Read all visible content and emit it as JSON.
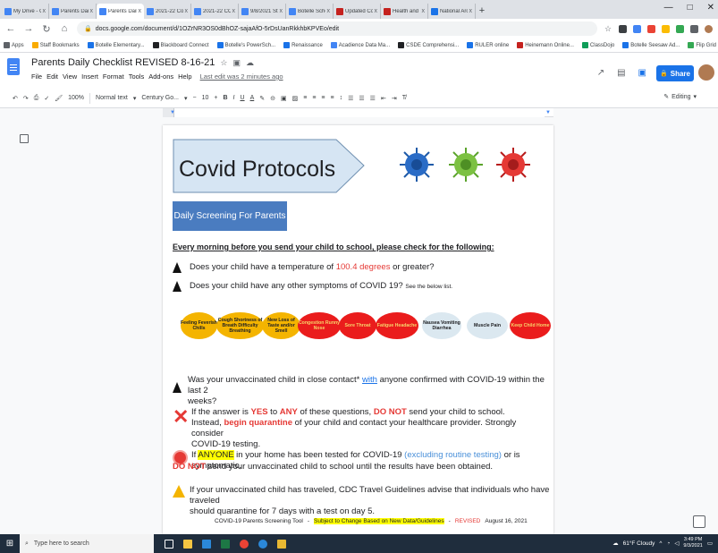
{
  "browser": {
    "tabs": [
      {
        "title": "My Drive - Googl",
        "color": "#4285f4"
      },
      {
        "title": "Parents Daily Chec",
        "color": "#4285f4"
      },
      {
        "title": "Parents Daily Chec",
        "color": "#4285f4",
        "active": true
      },
      {
        "title": "2021-22 Communi",
        "color": "#4285f4"
      },
      {
        "title": "2021-22 COVID P",
        "color": "#4285f4"
      },
      {
        "title": "9/8/2021 Staff Me",
        "color": "#4285f4"
      },
      {
        "title": "Botelle School - C",
        "color": "#4285f4"
      },
      {
        "title": "Updated Covid Pr",
        "color": "#c5221f"
      },
      {
        "title": "Health and Safety",
        "color": "#c5221f"
      },
      {
        "title": "National Archives",
        "color": "#1a73e8"
      }
    ],
    "close_glyph": "x",
    "new_tab": "+",
    "window_controls": [
      "—",
      "□",
      "✕"
    ],
    "url": "docs.google.com/document/d/1OZrNR3OS0dBhOZ-sajaAfO-5rDsUanRkkhbKPVEo/edit"
  },
  "bookmarks": [
    {
      "label": "Apps",
      "color": "#5f6368"
    },
    {
      "label": "Staff Bookmarks",
      "color": "#f9ab00"
    },
    {
      "label": "Botelle Elementary...",
      "color": "#1a73e8"
    },
    {
      "label": "Blackboard Connect",
      "color": "#202124"
    },
    {
      "label": "Botelle's PowerSch...",
      "color": "#1a73e8"
    },
    {
      "label": "Renaissance",
      "color": "#1a73e8"
    },
    {
      "label": "Acadience Data Ma...",
      "color": "#4285f4"
    },
    {
      "label": "CSDE Comprehensi...",
      "color": "#202124"
    },
    {
      "label": "RULER online",
      "color": "#1a73e8"
    },
    {
      "label": "Heinemann Online...",
      "color": "#c5221f"
    },
    {
      "label": "ClassDojo",
      "color": "#0f9d58"
    },
    {
      "label": "Botelle Seesaw Ad...",
      "color": "#1a73e8"
    },
    {
      "label": "Flip Grid",
      "color": "#34a853"
    },
    {
      "label": "Other bookmarks",
      "color": "#f9ab00"
    },
    {
      "label": "Reading li",
      "color": "#5f6368"
    }
  ],
  "docs": {
    "title": "Parents Daily Checklist REVISED 8-16-21",
    "menus": [
      "File",
      "Edit",
      "View",
      "Insert",
      "Format",
      "Tools",
      "Add-ons",
      "Help"
    ],
    "last_edit": "Last edit was 2 minutes ago",
    "share_label": "Share",
    "editing_label": "Editing",
    "toolbar": {
      "zoom": "100%",
      "style": "Normal text",
      "font": "Century Go...",
      "size": "10"
    }
  },
  "document": {
    "banner_title": "Covid Protocols",
    "screening_box": "Daily Screening For Parents",
    "heading": "Every morning before you send your child to school, please check for the following:",
    "q1_pre": "Does your child have a temperature of ",
    "q1_temp": "100.4 degrees",
    "q1_post": " or greater?",
    "q2_main": "Does your child have any other symptoms of COVID 19?",
    "q2_small": "See the below list.",
    "symptoms": [
      {
        "label": "Feeling Feverish Chills",
        "bg": "#f4b400",
        "fg": "#202124"
      },
      {
        "label": "Cough Shortness of Breath Difficulty Breathing",
        "bg": "#f4b400",
        "fg": "#202124"
      },
      {
        "label": "New Loss of Taste and/or Smell",
        "bg": "#f4b400",
        "fg": "#202124"
      },
      {
        "label": "Congestion Runny Nose",
        "bg": "#ea1c1c",
        "fg": "#f8d36a"
      },
      {
        "label": "Sore Throat",
        "bg": "#ea1c1c",
        "fg": "#f8d36a"
      },
      {
        "label": "Fatigue Headache",
        "bg": "#ea1c1c",
        "fg": "#f8d36a"
      },
      {
        "label": "Nausea Vomiting Diarrhea",
        "bg": "#dbe8f0",
        "fg": "#202124"
      },
      {
        "label": "Muscle Pain",
        "bg": "#dbe8f0",
        "fg": "#202124"
      },
      {
        "label": "Keep Child Home",
        "bg": "#ea1c1c",
        "fg": "#f8d36a"
      }
    ],
    "q3_a": "Was your unvaccinated child in close contact* ",
    "q3_with": "with",
    "q3_b": " anyone confirmed with COVID-19 within the last 2",
    "q3_c": "weeks?",
    "x_a": "If the answer is ",
    "x_yes": "YES",
    "x_b": " to ",
    "x_any": "ANY",
    "x_c": " of these questions, ",
    "x_donot": "DO NOT",
    "x_d": " send your child to school.",
    "x_e": "Instead, ",
    "x_quar": "begin quarantine",
    "x_f": " of your child and contact your healthcare provider. Strongly consider",
    "x_g": "COVID-19 testing.",
    "s_a": "If ",
    "s_anyone": "ANYONE",
    "s_b": " in your home has been tested for COVID-19 ",
    "s_excl": "(excluding routine testing)",
    "s_c": " or is symptomatic,",
    "s_donot": "DO NOT",
    "s_d": " send your unvaccinated child to school until the results have been obtained.",
    "w_a": "If your unvaccinated child has traveled, CDC Travel Guidelines advise that individuals who have traveled",
    "w_b": "should quarantine for 7 days with a test on day 5.",
    "footer_tool": "COVID-19 Parents Screening Tool",
    "footer_dash": "-",
    "footer_change": "Subject to Change Based on New Data/Guidelines",
    "footer_revised": "REVISED",
    "footer_date": "August 16, 2021"
  },
  "taskbar": {
    "search_placeholder": "Type here to search",
    "weather": "61°F Cloudy",
    "time": "3:49 PM",
    "date": "9/3/2021"
  }
}
